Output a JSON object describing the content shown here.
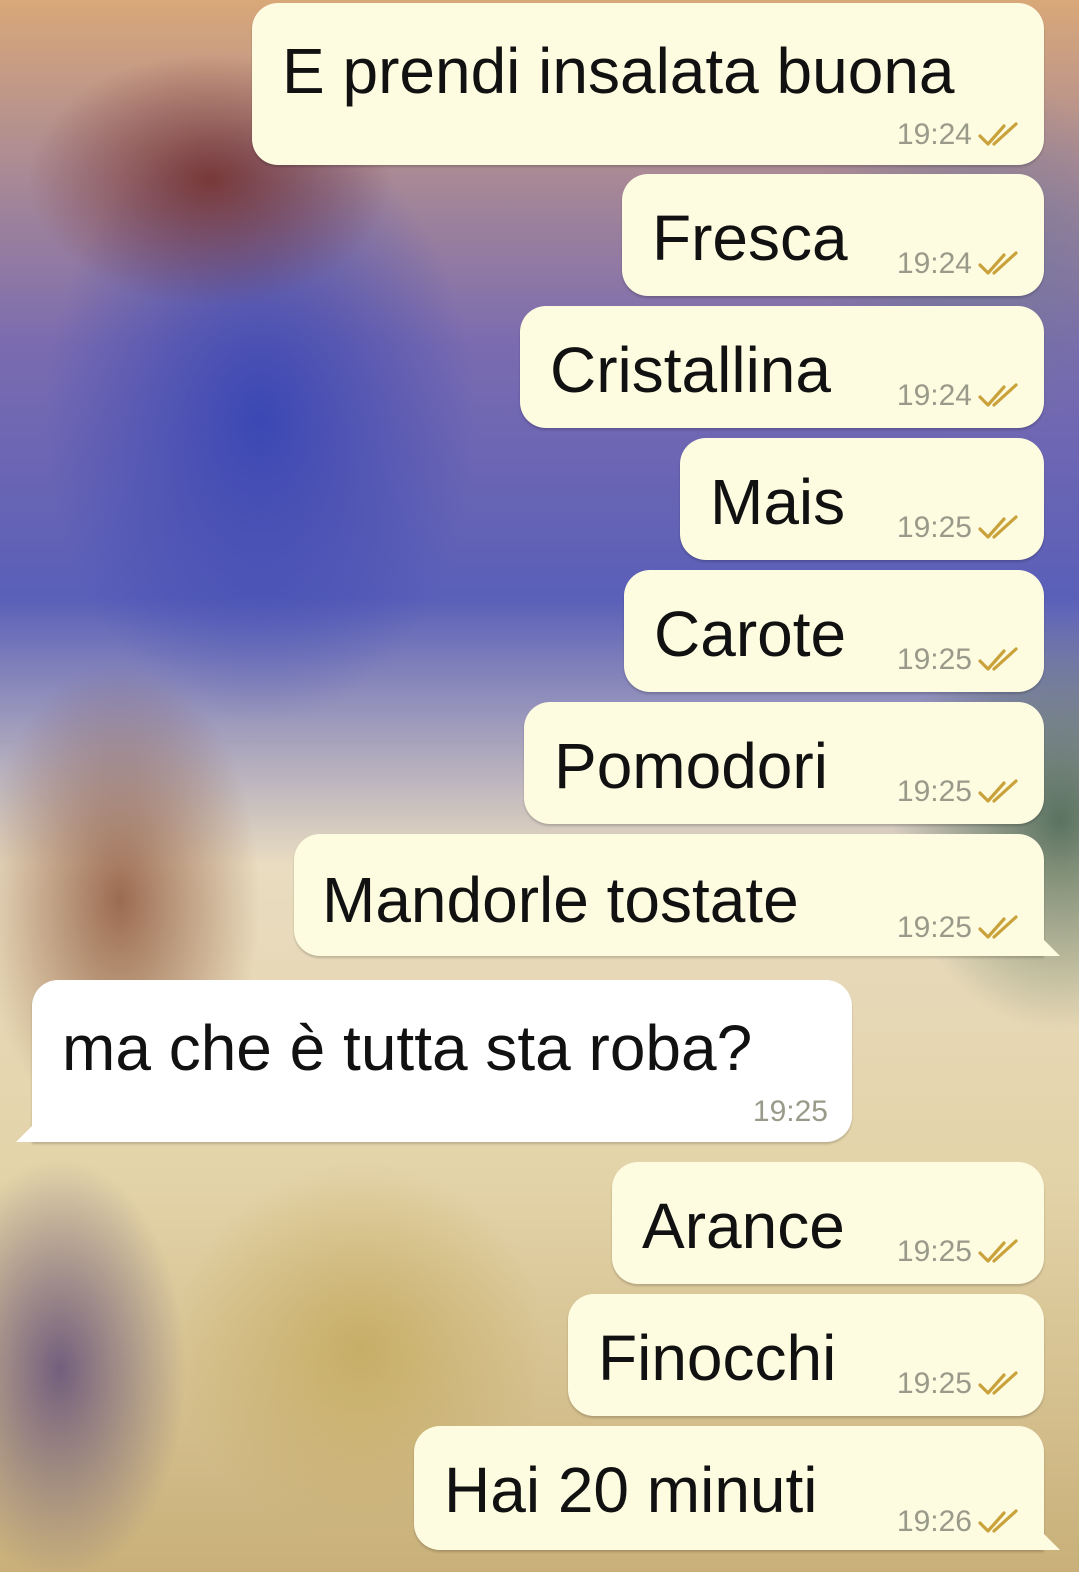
{
  "messages": [
    {
      "text": "E prendi insalata buona",
      "time": "19:24",
      "direction": "outgoing",
      "status_icon": "double-check-read-icon"
    },
    {
      "text": "Fresca",
      "time": "19:24",
      "direction": "outgoing",
      "status_icon": "double-check-read-icon"
    },
    {
      "text": "Cristallina",
      "time": "19:24",
      "direction": "outgoing",
      "status_icon": "double-check-read-icon"
    },
    {
      "text": "Mais",
      "time": "19:25",
      "direction": "outgoing",
      "status_icon": "double-check-read-icon"
    },
    {
      "text": "Carote",
      "time": "19:25",
      "direction": "outgoing",
      "status_icon": "double-check-read-icon"
    },
    {
      "text": "Pomodori",
      "time": "19:25",
      "direction": "outgoing",
      "status_icon": "double-check-read-icon"
    },
    {
      "text": "Mandorle tostate",
      "time": "19:25",
      "direction": "outgoing",
      "status_icon": "double-check-read-icon"
    },
    {
      "text": "ma che è tutta sta roba?",
      "time": "19:25",
      "direction": "incoming"
    },
    {
      "text": "Arance",
      "time": "19:25",
      "direction": "outgoing",
      "status_icon": "double-check-read-icon"
    },
    {
      "text": "Finocchi",
      "time": "19:25",
      "direction": "outgoing",
      "status_icon": "double-check-read-icon"
    },
    {
      "text": "Hai 20 minuti",
      "time": "19:26",
      "direction": "outgoing",
      "status_icon": "double-check-read-icon"
    }
  ],
  "colors": {
    "outgoing_bubble": "#fdfbe0",
    "incoming_bubble": "#ffffff",
    "read_ticks": "#c9a23c",
    "timestamp": "#9a9a8a"
  }
}
